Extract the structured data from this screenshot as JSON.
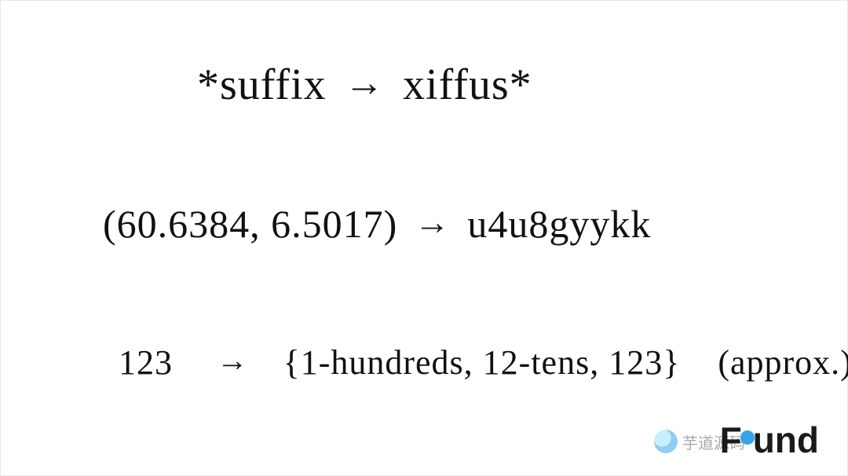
{
  "diagram": {
    "line1": {
      "left_prefix": "*",
      "left_text": "suffix",
      "right_text": "xiffus",
      "right_suffix": "*"
    },
    "line2": {
      "coord_open": "(",
      "lat": "60.6384",
      "sep": ", ",
      "lon": "6.5017",
      "coord_close": ")",
      "geohash": "u4u8gyykk"
    },
    "line3": {
      "number": "123",
      "set_open": "{",
      "token1": "1-hundreds",
      "comma1": ", ",
      "token2": "12-tens",
      "comma2": ", ",
      "token3": "123",
      "set_close": "}",
      "note": "(approx.)"
    },
    "arrow_glyph": "→"
  },
  "branding": {
    "logo_text_main": "F",
    "logo_text_rest": "und",
    "watermark_text": "芋道源码"
  }
}
